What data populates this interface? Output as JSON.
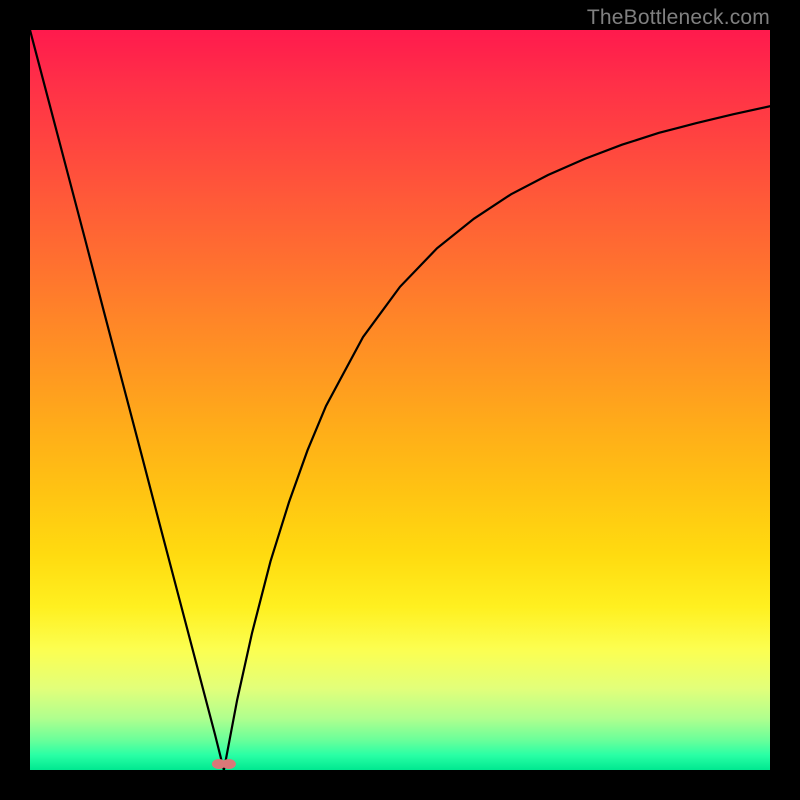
{
  "watermark": {
    "text": "TheBottleneck.com"
  },
  "chart_data": {
    "type": "line",
    "title": "",
    "xlabel": "",
    "ylabel": "",
    "xlim": [
      0,
      1
    ],
    "ylim": [
      0,
      1
    ],
    "gradient_background": true,
    "series": [
      {
        "name": "left-branch",
        "x": [
          0.0,
          0.025,
          0.05,
          0.075,
          0.1,
          0.125,
          0.15,
          0.175,
          0.2,
          0.225,
          0.25,
          0.262
        ],
        "values": [
          1.0,
          0.905,
          0.81,
          0.715,
          0.619,
          0.524,
          0.429,
          0.333,
          0.238,
          0.143,
          0.048,
          0.0
        ]
      },
      {
        "name": "right-branch",
        "x": [
          0.262,
          0.28,
          0.3,
          0.325,
          0.35,
          0.375,
          0.4,
          0.45,
          0.5,
          0.55,
          0.6,
          0.65,
          0.7,
          0.75,
          0.8,
          0.85,
          0.9,
          0.95,
          1.0
        ],
        "values": [
          0.0,
          0.095,
          0.185,
          0.282,
          0.362,
          0.432,
          0.492,
          0.585,
          0.653,
          0.705,
          0.745,
          0.778,
          0.804,
          0.826,
          0.845,
          0.861,
          0.874,
          0.886,
          0.897
        ]
      }
    ],
    "marker": {
      "name": "minimum-marker",
      "x": 0.262,
      "y": 0.0,
      "color": "#d97878"
    }
  }
}
